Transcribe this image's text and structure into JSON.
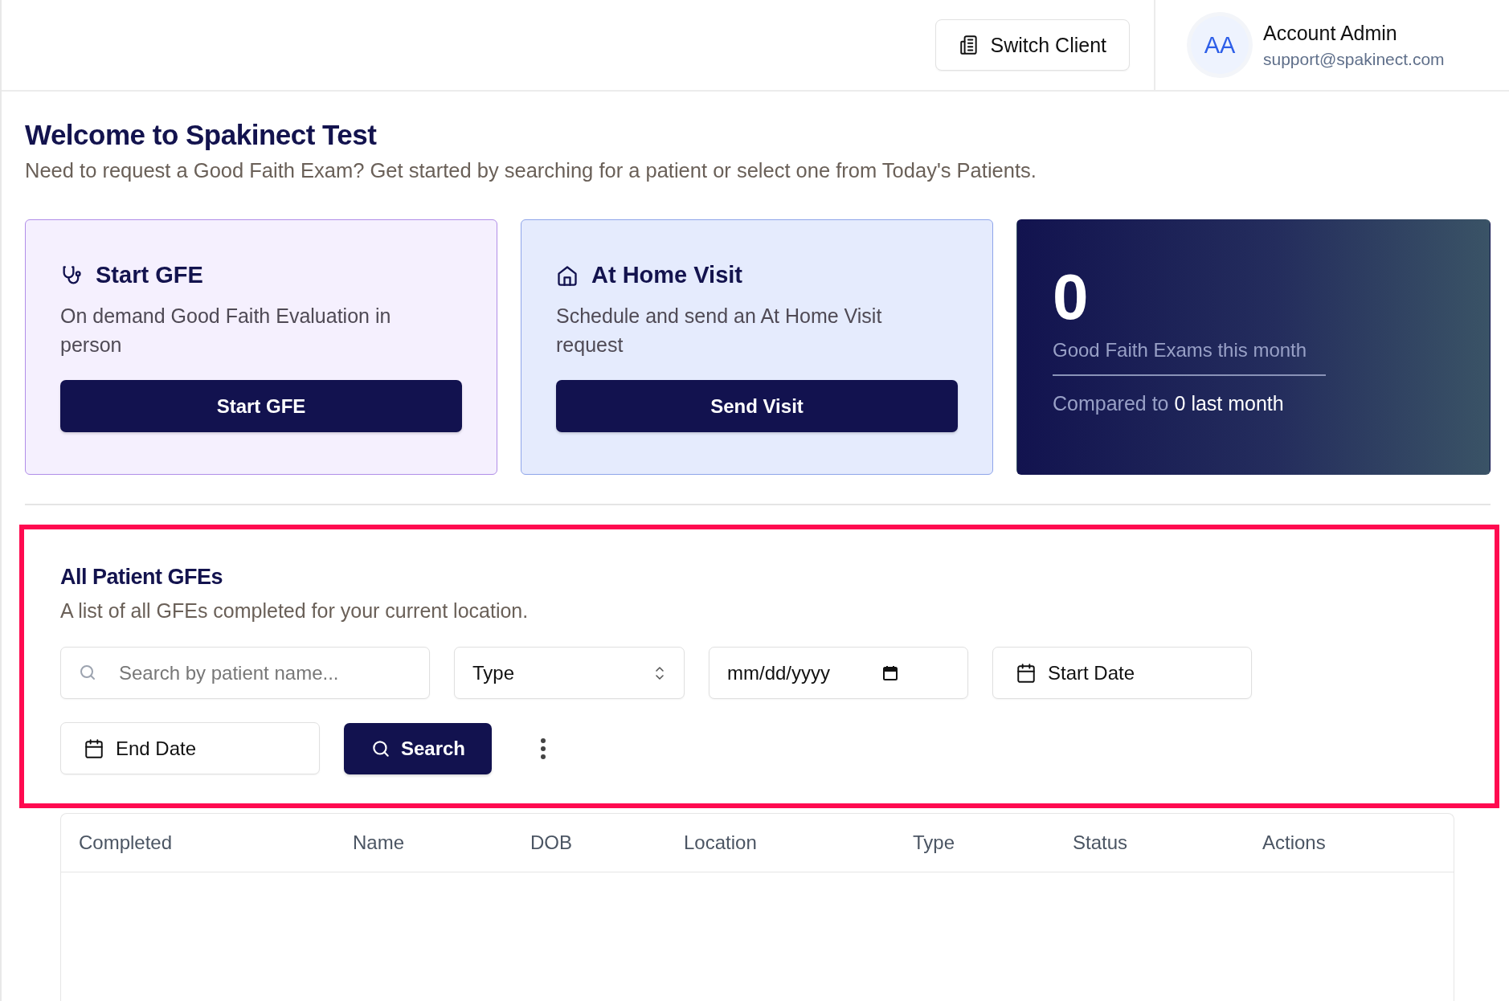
{
  "header": {
    "switch_client": "Switch Client",
    "user": {
      "initials": "AA",
      "name": "Account Admin",
      "email": "support@spakinect.com"
    }
  },
  "welcome": {
    "title": "Welcome to Spakinect Test",
    "subtitle": "Need to request a Good Faith Exam? Get started by searching for a patient or select one from Today's Patients."
  },
  "action_cards": [
    {
      "kind": "stethoscope",
      "title": "Start GFE",
      "description": "On demand Good Faith Evaluation in person",
      "button": "Start GFE"
    },
    {
      "kind": "home",
      "title": "At Home Visit",
      "description": "Schedule and send an At Home Visit request",
      "button": "Send Visit"
    }
  ],
  "stats_card": {
    "value": "0",
    "label": "Good Faith Exams this month",
    "comparison_prefix": "Compared to",
    "comparison_value": "0 last month"
  },
  "patient_gfes": {
    "title": "All Patient GFEs",
    "description": "A list of all GFEs completed for your current location.",
    "filters": {
      "search_placeholder": "Search by patient name...",
      "type_placeholder": "Type",
      "date_placeholder": "mm/dd/yyyy",
      "start_date": "Start Date",
      "end_date": "End Date",
      "search_button": "Search"
    },
    "table": {
      "columns": [
        "Completed",
        "Name",
        "DOB",
        "Location",
        "Type",
        "Status",
        "Actions"
      ]
    }
  }
}
